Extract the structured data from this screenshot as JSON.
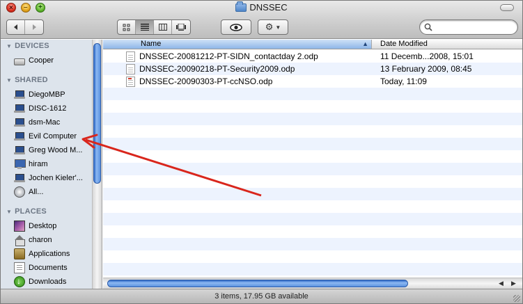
{
  "window": {
    "title": "DNSSEC"
  },
  "toolbar": {
    "back_icon": "back-arrow-icon",
    "forward_icon": "forward-arrow-icon",
    "views": [
      {
        "name": "icon-view",
        "active": false
      },
      {
        "name": "list-view",
        "active": true
      },
      {
        "name": "column-view",
        "active": false
      },
      {
        "name": "coverflow-view",
        "active": false
      }
    ],
    "quicklook_icon": "eye-icon",
    "action_icon": "gear-icon",
    "search_placeholder": ""
  },
  "sidebar": {
    "sections": [
      {
        "label": "DEVICES"
      },
      {
        "label": "SHARED"
      },
      {
        "label": "PLACES"
      }
    ],
    "devices": [
      {
        "label": "Cooper",
        "icon": "hard-drive-icon"
      }
    ],
    "shared": [
      {
        "label": "DiegoMBP",
        "icon": "laptop-icon"
      },
      {
        "label": "DISC-1612",
        "icon": "laptop-icon"
      },
      {
        "label": "dsm-Mac",
        "icon": "laptop-icon"
      },
      {
        "label": "Evil Computer",
        "icon": "laptop-icon"
      },
      {
        "label": "Greg Wood M...",
        "icon": "laptop-icon"
      },
      {
        "label": "hiram",
        "icon": "imac-icon"
      },
      {
        "label": "Jochen Kieler'...",
        "icon": "laptop-icon"
      },
      {
        "label": "All...",
        "icon": "network-globe-icon"
      }
    ],
    "places": [
      {
        "label": "Desktop",
        "icon": "desktop-icon"
      },
      {
        "label": "charon",
        "icon": "home-icon"
      },
      {
        "label": "Applications",
        "icon": "applications-icon"
      },
      {
        "label": "Documents",
        "icon": "documents-icon"
      },
      {
        "label": "Downloads",
        "icon": "downloads-icon"
      }
    ]
  },
  "file_list": {
    "columns": {
      "name": "Name",
      "date": "Date Modified"
    },
    "files": [
      {
        "name": "DNSSEC-20081212-PT-SIDN_contactday 2.odp",
        "date": "11 Decemb...2008, 15:01"
      },
      {
        "name": "DNSSEC-20090218-PT-Security2009.odp",
        "date": "13 February 2009, 08:45"
      },
      {
        "name": "DNSSEC-20090303-PT-ccNSO.odp",
        "date": "Today, 11:09"
      }
    ]
  },
  "status": {
    "text": "3 items, 17.95 GB available"
  },
  "annotation": {
    "color": "#d9261c"
  }
}
